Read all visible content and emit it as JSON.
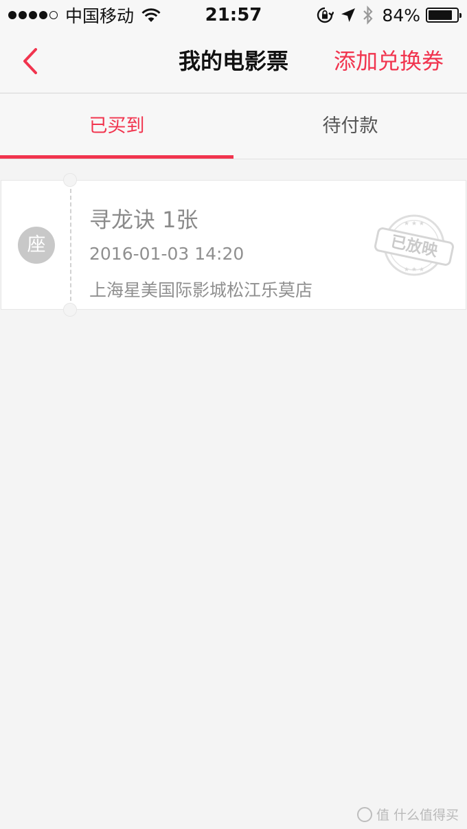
{
  "status_bar": {
    "carrier": "中国移动",
    "time": "21:57",
    "battery_percent": "84%",
    "battery_level": 0.84,
    "icons": [
      "signal-dots-icon",
      "wifi-icon",
      "rotation-lock-icon",
      "location-arrow-icon",
      "bluetooth-icon",
      "battery-icon"
    ]
  },
  "nav": {
    "back_icon": "chevron-left-icon",
    "title": "我的电影票",
    "action": "添加兑换券"
  },
  "tabs": [
    {
      "label": "已买到",
      "active": true
    },
    {
      "label": "待付款",
      "active": false
    }
  ],
  "tickets": [
    {
      "seat_badge": "座",
      "title": "寻龙诀 1张",
      "showtime": "2016-01-03 14:20",
      "cinema": "上海星美国际影城松江乐莫店",
      "stamp": "已放映"
    }
  ],
  "watermark": {
    "text": "值 什么值得买"
  },
  "colors": {
    "accent": "#f1344e",
    "background": "#f4f4f4",
    "card": "#ffffff",
    "muted_text": "#8f8f8f"
  }
}
